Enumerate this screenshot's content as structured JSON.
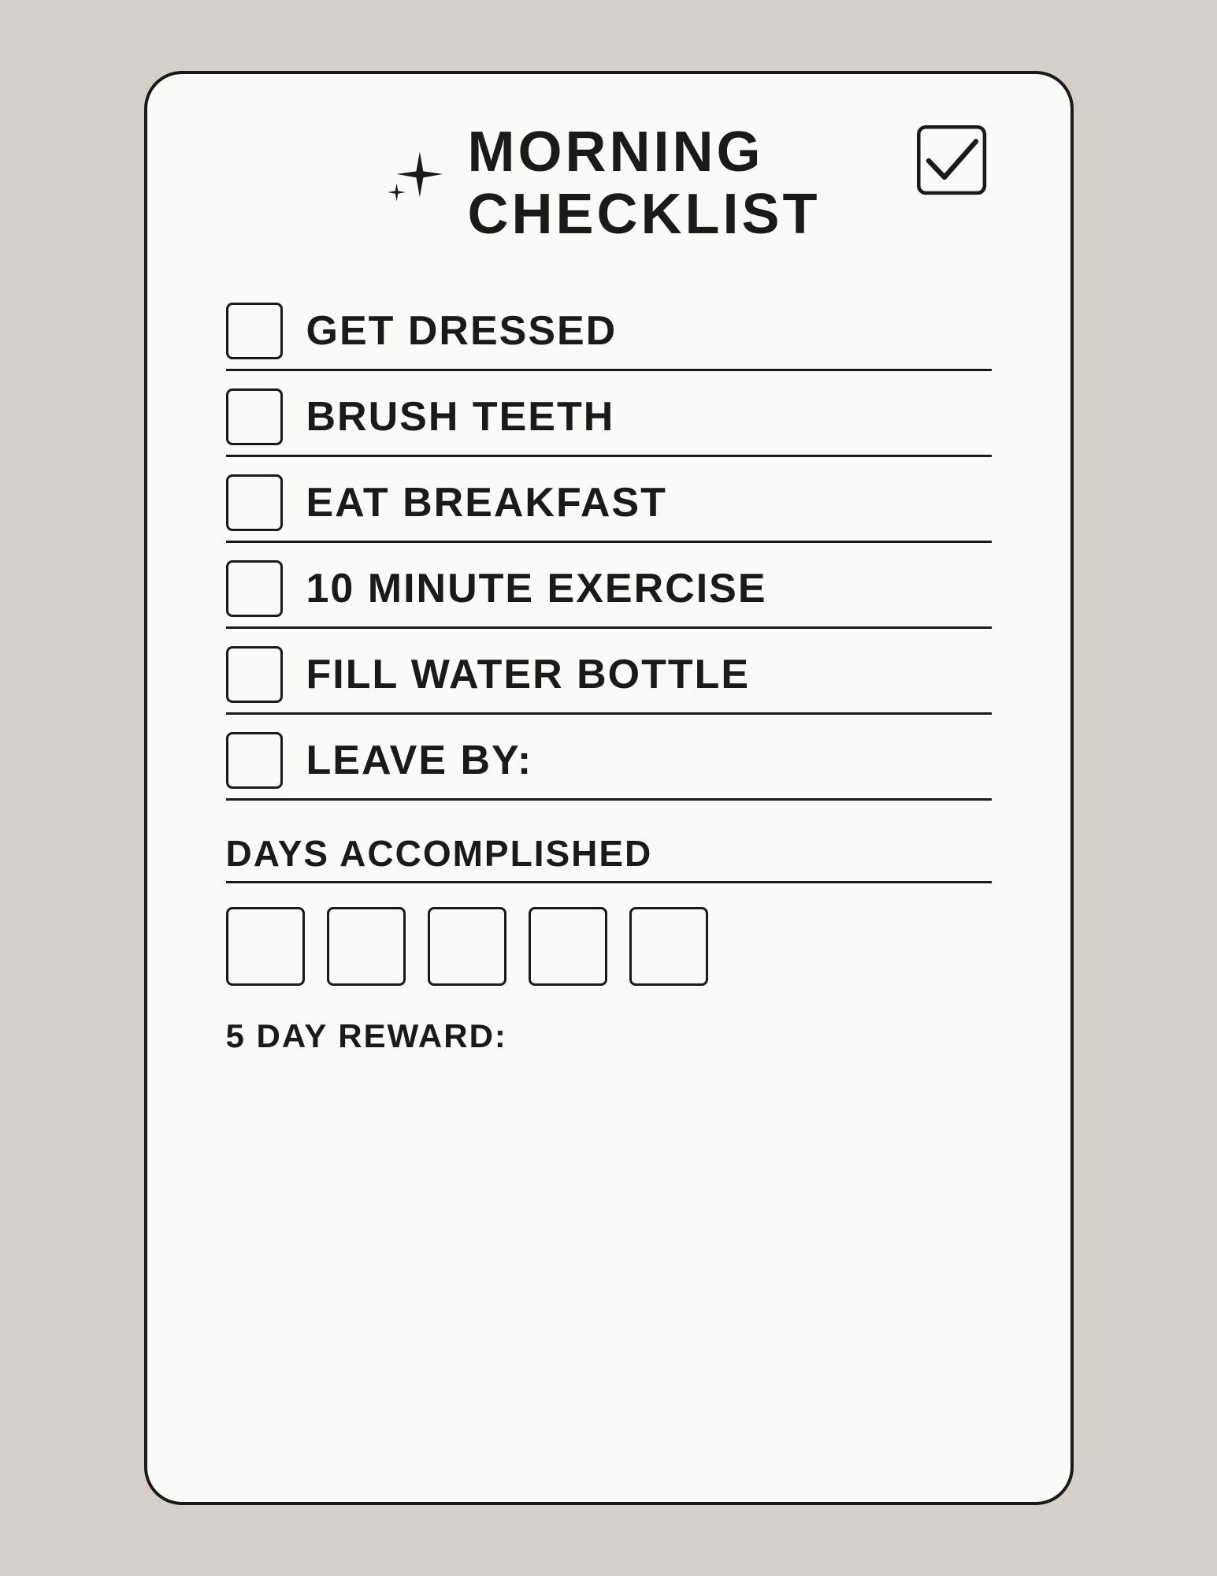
{
  "page": {
    "background_color": "#d6cfc7"
  },
  "card": {
    "title_line1": "Morning",
    "title_line2": "Checklist"
  },
  "checklist": {
    "items": [
      {
        "id": "get-dressed",
        "label": "Get Dressed"
      },
      {
        "id": "brush-teeth",
        "label": "BRuSH Teeth"
      },
      {
        "id": "eat-breakfast",
        "label": "Eat Breakfast"
      },
      {
        "id": "10-minute-exercise",
        "label": "10 Minute Exercise"
      },
      {
        "id": "fill-water-bottle",
        "label": "Fill WATER Bottle"
      },
      {
        "id": "leave-by",
        "label": "Leave By:"
      }
    ]
  },
  "days_section": {
    "label": "Days Accomplished",
    "box_count": 5,
    "reward_label": "5 Day Reward:"
  }
}
